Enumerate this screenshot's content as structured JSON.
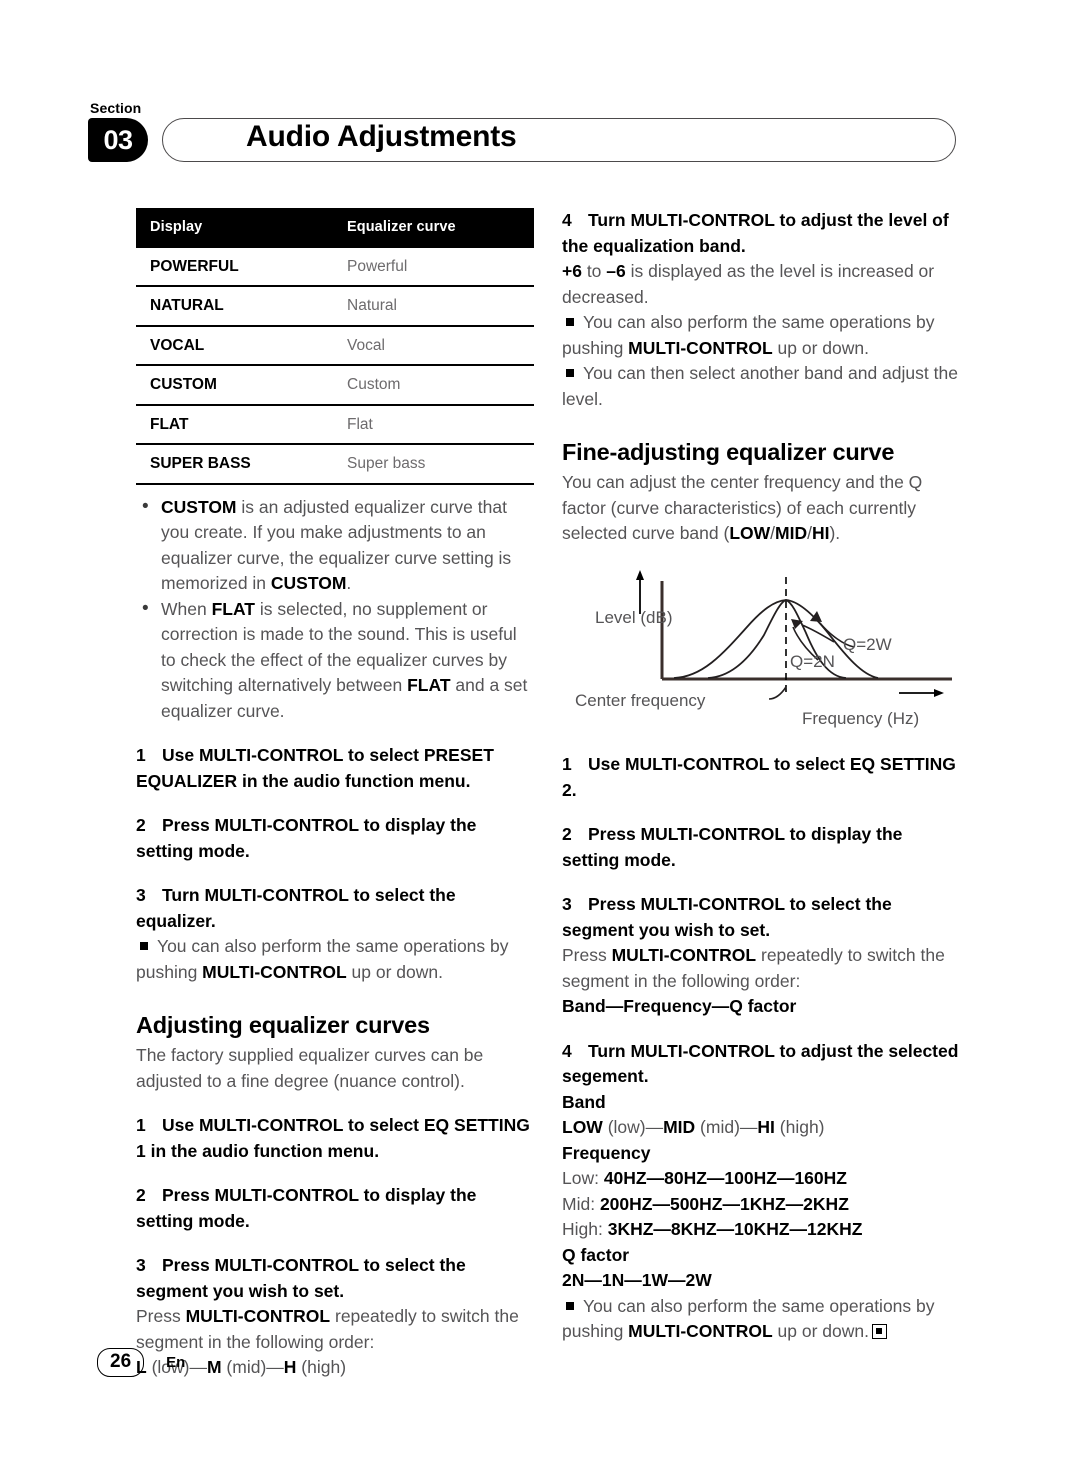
{
  "header": {
    "section_label": "Section",
    "section_number": "03",
    "title": "Audio Adjustments"
  },
  "table": {
    "columns": [
      "Display",
      "Equalizer curve"
    ],
    "rows": [
      [
        "POWERFUL",
        "Powerful"
      ],
      [
        "NATURAL",
        "Natural"
      ],
      [
        "VOCAL",
        "Vocal"
      ],
      [
        "CUSTOM",
        "Custom"
      ],
      [
        "FLAT",
        "Flat"
      ],
      [
        "SUPER BASS",
        "Super bass"
      ]
    ]
  },
  "left_column": {
    "bullet_1_html": "<b>CUSTOM</b> is an adjusted equalizer curve that you create. If you make adjustments to an equalizer curve, the equalizer curve setting is memorized in <b>CUSTOM</b>.",
    "bullet_2_html": "When <b>FLAT</b> is selected, no supplement or correction is made to the sound. This is useful to check the effect of the equalizer curves by switching alternatively between <b>FLAT</b> and a set equalizer curve.",
    "step_1_html": "<span class=\"num\">1</span>Use MULTI-CONTROL to select PRESET EQUALIZER in the audio function menu.",
    "step_2_html": "<span class=\"num\">2</span>Press MULTI-CONTROL to display the setting mode.",
    "step_3_html": "<span class=\"num\">3</span>Turn MULTI-CONTROL to select the equalizer.",
    "note_1_html": "<span class=\"sq\"></span>You can also perform the same operations by pushing <b>MULTI-CONTROL</b> up or down.",
    "heading_adjusting": "Adjusting equalizer curves",
    "intro_adjusting": "The factory supplied equalizer curves can be adjusted to a fine degree (nuance control).",
    "step_a1_html": "<span class=\"num\">1</span>Use MULTI-CONTROL to select EQ SETTING 1 in the audio function menu.",
    "step_a2_html": "<span class=\"num\">2</span>Press MULTI-CONTROL to display the setting mode.",
    "step_a3_html": "<span class=\"num\">3</span>Press MULTI-CONTROL to select the segment you wish to set.",
    "step_a3_body_html": "Press <b>MULTI-CONTROL</b> repeatedly to switch the segment in the following order:",
    "segment_order_html": "<b>L</b> (low)&#8212;<b>M</b> (mid)&#8212;<b>H</b> (high)"
  },
  "right_column": {
    "step_4_html": "<span class=\"num\">4</span>Turn MULTI-CONTROL to adjust the level of the equalization band.",
    "step_4_body_html": "<b>+6</b> to <b>&#8211;6</b> is displayed as the level is increased or decreased.",
    "note_1_html": "<span class=\"sq\"></span>You can also perform the same operations by pushing <b>MULTI-CONTROL</b> up or down.",
    "note_2_html": "<span class=\"sq\"></span>You can then select another band and adjust the level.",
    "heading_fine": "Fine-adjusting equalizer curve",
    "intro_fine_html": "You can adjust the center frequency and the Q factor (curve characteristics) of each currently selected curve band (<b>LOW</b>/<b>MID</b>/<b>HI</b>).",
    "step_b1_html": "<span class=\"num\">1</span>Use MULTI-CONTROL to select EQ SETTING 2.",
    "step_b2_html": "<span class=\"num\">2</span>Press MULTI-CONTROL to display the setting mode.",
    "step_b3_html": "<span class=\"num\">3</span>Press MULTI-CONTROL to select the segment you wish to set.",
    "step_b3_body_html": "Press <b>MULTI-CONTROL</b> repeatedly to switch the segment in the following order:",
    "segment_order_html": "<b>Band&#8212;Frequency&#8212;Q factor</b>",
    "step_b4_html": "<span class=\"num\">4</span>Turn MULTI-CONTROL to adjust the selected segement.",
    "band_label": "Band",
    "band_values_html": "<b>LOW</b> (low)&#8212;<b>MID</b> (mid)&#8212;<b>HI</b> (high)",
    "frequency_label": "Frequency",
    "frequency_low_html": "Low: <b>40HZ&#8212;80HZ&#8212;100HZ&#8212;160HZ</b>",
    "frequency_mid_html": "Mid: <b>200HZ&#8212;500HZ&#8212;1KHZ&#8212;2KHZ</b>",
    "frequency_high_html": "High: <b>3KHZ&#8212;8KHZ&#8212;10KHZ&#8212;12KHZ</b>",
    "q_label": "Q factor",
    "q_values_html": "<b>2N&#8212;1N&#8212;1W&#8212;2W</b>",
    "note_final_html": "<span class=\"sq\"></span>You can also perform the same operations by pushing <b>MULTI-CONTROL</b> up or down.<span class=\"endmark\"></span>"
  },
  "diagram": {
    "y_axis_label": "Level (dB)",
    "x_axis_label": "Frequency (Hz)",
    "center_frequency_label": "Center frequency",
    "curve_narrow_label": "Q=2N",
    "curve_wide_label": "Q=2W"
  },
  "footer": {
    "page_number": "26",
    "language": "En"
  }
}
